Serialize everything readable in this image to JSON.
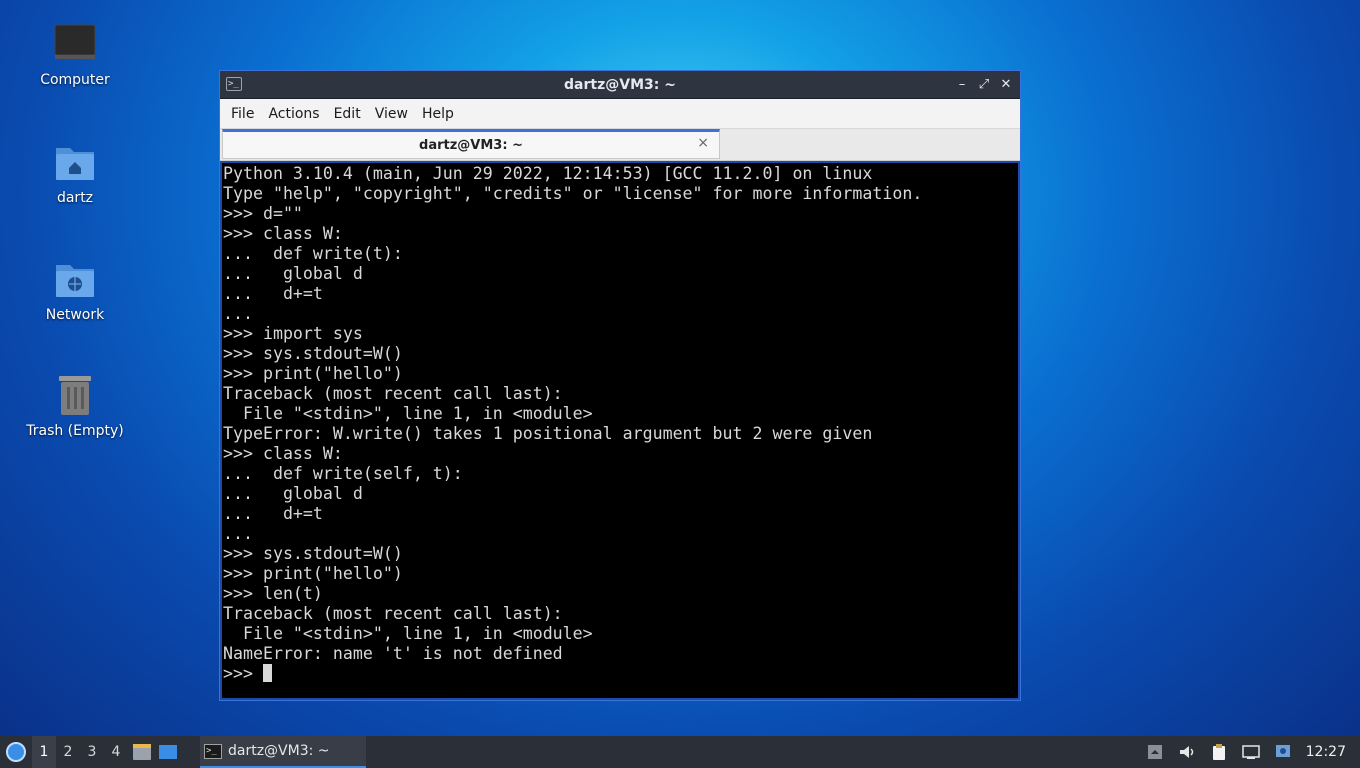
{
  "desktop": {
    "icons": [
      {
        "label": "Computer"
      },
      {
        "label": "dartz"
      },
      {
        "label": "Network"
      },
      {
        "label": "Trash (Empty)"
      }
    ]
  },
  "window": {
    "title": "dartz@VM3: ~",
    "menu": [
      "File",
      "Actions",
      "Edit",
      "View",
      "Help"
    ],
    "tab_label": "dartz@VM3: ~",
    "tab_close": "×"
  },
  "terminal": {
    "lines": [
      "Python 3.10.4 (main, Jun 29 2022, 12:14:53) [GCC 11.2.0] on linux",
      "Type \"help\", \"copyright\", \"credits\" or \"license\" for more information.",
      ">>> d=\"\"",
      ">>> class W:",
      "...  def write(t):",
      "...   global d",
      "...   d+=t",
      "...",
      ">>> import sys",
      ">>> sys.stdout=W()",
      ">>> print(\"hello\")",
      "Traceback (most recent call last):",
      "  File \"<stdin>\", line 1, in <module>",
      "TypeError: W.write() takes 1 positional argument but 2 were given",
      ">>> class W:",
      "...  def write(self, t):",
      "...   global d",
      "...   d+=t",
      "...",
      ">>> sys.stdout=W()",
      ">>> print(\"hello\")",
      ">>> len(t)",
      "Traceback (most recent call last):",
      "  File \"<stdin>\", line 1, in <module>",
      "NameError: name 't' is not defined"
    ],
    "prompt": ">>> "
  },
  "taskbar": {
    "workspaces": [
      "1",
      "2",
      "3",
      "4"
    ],
    "active_workspace": "1",
    "task_label": "dartz@VM3: ~",
    "clock": "12:27"
  }
}
